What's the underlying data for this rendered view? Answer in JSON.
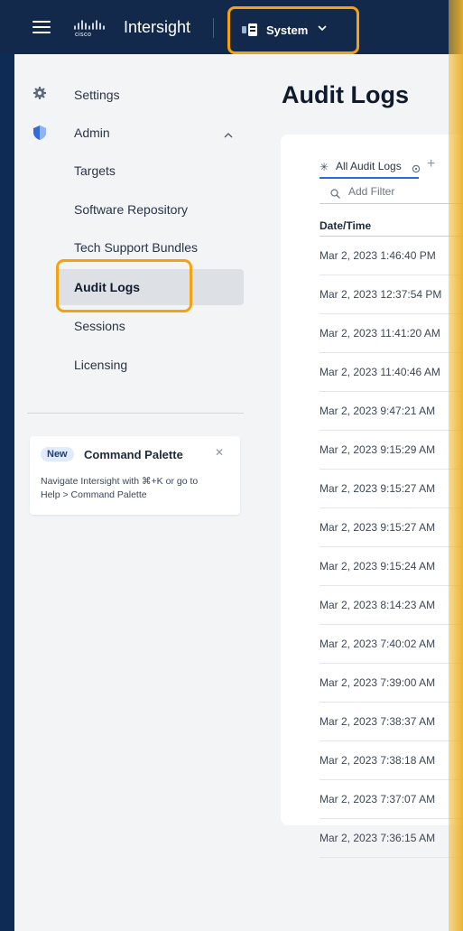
{
  "topbar": {
    "menu_icon": "hamburger-menu-icon",
    "logo_icon": "cisco-logo-icon",
    "logo_text": "cisco",
    "app_name": "Intersight",
    "scope_selector": {
      "icon": "server-icon",
      "label": "System",
      "chevron": "chevron-down-icon"
    }
  },
  "sidebar": {
    "items": [
      {
        "label": "Settings",
        "icon": "gear-icon"
      },
      {
        "label": "Admin",
        "icon": "shield-icon",
        "expanded": true
      }
    ],
    "admin_children": [
      {
        "label": "Targets"
      },
      {
        "label": "Software Repository"
      },
      {
        "label": "Tech Support Bundles"
      },
      {
        "label": "Audit Logs",
        "active": true
      },
      {
        "label": "Sessions"
      },
      {
        "label": "Licensing"
      }
    ],
    "promo": {
      "badge": "New",
      "title": "Command Palette",
      "close_icon": "close-icon",
      "body_line1": "Navigate Intersight with ⌘+K or go to",
      "body_line2": "Help > Command Palette"
    }
  },
  "main": {
    "title": "Audit Logs",
    "tab": {
      "icon": "asterisk-icon",
      "label": "All Audit Logs",
      "settings_icon": "gear-icon",
      "add_icon": "plus-icon"
    },
    "filter": {
      "icon": "search-icon",
      "placeholder": "Add Filter"
    },
    "table": {
      "columns": [
        "Date/Time"
      ],
      "rows": [
        "Mar 2, 2023 1:46:40 PM",
        "Mar 2, 2023 12:37:54 PM",
        "Mar 2, 2023 11:41:20 AM",
        "Mar 2, 2023 11:40:46 AM",
        "Mar 2, 2023 9:47:21 AM",
        "Mar 2, 2023 9:15:29 AM",
        "Mar 2, 2023 9:15:27 AM",
        "Mar 2, 2023 9:15:27 AM",
        "Mar 2, 2023 9:15:24 AM",
        "Mar 2, 2023 8:14:23 AM",
        "Mar 2, 2023 7:40:02 AM",
        "Mar 2, 2023 7:39:00 AM",
        "Mar 2, 2023 7:38:37 AM",
        "Mar 2, 2023 7:38:18 AM",
        "Mar 2, 2023 7:37:07 AM",
        "Mar 2, 2023 7:36:15 AM"
      ]
    }
  },
  "colors": {
    "topbar": "#13294b",
    "highlight": "#f4a20f",
    "accent": "#2a6ae6"
  }
}
